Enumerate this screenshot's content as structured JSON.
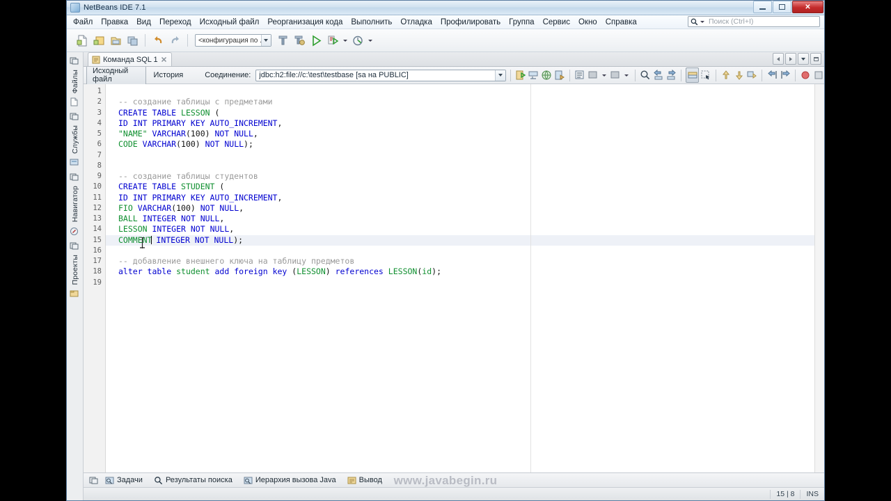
{
  "window": {
    "title": "NetBeans IDE 7.1",
    "app_icon": "netbeans-icon",
    "minimize_label": "Свернуть",
    "maximize_label": "Развернуть",
    "close_label": "Закрыть"
  },
  "menubar": {
    "items": [
      "Файл",
      "Правка",
      "Вид",
      "Переход",
      "Исходный файл",
      "Реорганизация кода",
      "Выполнить",
      "Отладка",
      "Профилировать",
      "Группа",
      "Сервис",
      "Окно",
      "Справка"
    ]
  },
  "search": {
    "placeholder": "Поиск (Ctrl+I)",
    "icon": "search-icon"
  },
  "toolbar": {
    "buttons": [
      "new-file-icon",
      "new-project-icon",
      "open-project-icon",
      "save-all-icon",
      "undo-icon",
      "redo-icon"
    ],
    "config_combo_value": "<конфигурация по ...",
    "run_buttons": [
      "build-project-icon",
      "clean-build-icon",
      "run-project-icon",
      "debug-project-icon",
      "profile-project-icon"
    ]
  },
  "sidebar": {
    "groups": [
      {
        "icon": "window-icon",
        "label": "Файлы",
        "doc_icon": "file-icon"
      },
      {
        "icon": "window-icon",
        "label": "Службы",
        "doc_icon": "services-icon"
      },
      {
        "icon": "window-icon",
        "label": "Навигатор",
        "doc_icon": "navigator-icon"
      },
      {
        "icon": "window-icon",
        "label": "Проекты",
        "doc_icon": "projects-icon"
      }
    ]
  },
  "tabs": {
    "documents": [
      {
        "label": "Команда SQL 1",
        "icon": "sql-doc-icon",
        "close": "close-icon",
        "active": true
      }
    ],
    "nav": [
      "scroll-left-icon",
      "scroll-right-icon",
      "tab-list-icon",
      "maximize-window-icon"
    ]
  },
  "editor_toolbar": {
    "view_source_label": "Исходный файл",
    "history_label": "История",
    "connection_label": "Соединение:",
    "connection_value": "jdbc:h2:file://c:\\test\\testbase [sa на PUBLIC]",
    "right_buttons": [
      "run-sql-icon",
      "run-statement-icon",
      "run-on-connection-icon",
      "sql-history-icon",
      "format-icon",
      "comment-icon",
      "uncomment-icon",
      "find-icon",
      "previous-match-icon",
      "next-match-icon",
      "toggle-rect-select-icon",
      "rect-select-icon",
      "shift-line-up-icon",
      "shift-line-down-icon",
      "copy-line-icon",
      "move-left-icon",
      "move-right-icon",
      "toggle-bookmark-icon",
      "stop-icon"
    ]
  },
  "code": {
    "lines": [
      {
        "num": "1",
        "tokens": []
      },
      {
        "num": "2",
        "tokens": [
          {
            "t": "-- создание таблицы с предметами",
            "c": "cmt"
          }
        ]
      },
      {
        "num": "3",
        "tokens": [
          {
            "t": "CREATE TABLE ",
            "c": "kw"
          },
          {
            "t": "LESSON",
            "c": "id"
          },
          {
            "t": " (",
            "c": "plain"
          }
        ]
      },
      {
        "num": "4",
        "tokens": [
          {
            "t": "ID INT PRIMARY KEY AUTO_INCREMENT",
            "c": "kw"
          },
          {
            "t": ",",
            "c": "plain"
          }
        ]
      },
      {
        "num": "5",
        "tokens": [
          {
            "t": "\"NAME\"",
            "c": "str"
          },
          {
            "t": " ",
            "c": "plain"
          },
          {
            "t": "VARCHAR",
            "c": "kw"
          },
          {
            "t": "(100) ",
            "c": "plain"
          },
          {
            "t": "NOT NULL",
            "c": "kw"
          },
          {
            "t": ",",
            "c": "plain"
          }
        ]
      },
      {
        "num": "6",
        "tokens": [
          {
            "t": "CODE",
            "c": "id"
          },
          {
            "t": " ",
            "c": "plain"
          },
          {
            "t": "VARCHAR",
            "c": "kw"
          },
          {
            "t": "(100) ",
            "c": "plain"
          },
          {
            "t": "NOT NULL",
            "c": "kw"
          },
          {
            "t": ");",
            "c": "plain"
          }
        ]
      },
      {
        "num": "7",
        "tokens": []
      },
      {
        "num": "8",
        "tokens": []
      },
      {
        "num": "9",
        "tokens": [
          {
            "t": "-- создание таблицы студентов",
            "c": "cmt"
          }
        ]
      },
      {
        "num": "10",
        "tokens": [
          {
            "t": "CREATE TABLE ",
            "c": "kw"
          },
          {
            "t": "STUDENT",
            "c": "id"
          },
          {
            "t": " (",
            "c": "plain"
          }
        ]
      },
      {
        "num": "11",
        "tokens": [
          {
            "t": "ID INT PRIMARY KEY AUTO_INCREMENT",
            "c": "kw"
          },
          {
            "t": ",",
            "c": "plain"
          }
        ]
      },
      {
        "num": "12",
        "tokens": [
          {
            "t": "FIO",
            "c": "id"
          },
          {
            "t": " ",
            "c": "plain"
          },
          {
            "t": "VARCHAR",
            "c": "kw"
          },
          {
            "t": "(100) ",
            "c": "plain"
          },
          {
            "t": "NOT NULL",
            "c": "kw"
          },
          {
            "t": ",",
            "c": "plain"
          }
        ]
      },
      {
        "num": "13",
        "tokens": [
          {
            "t": "BALL",
            "c": "id"
          },
          {
            "t": " ",
            "c": "plain"
          },
          {
            "t": "INTEGER NOT NULL",
            "c": "kw"
          },
          {
            "t": ",",
            "c": "plain"
          }
        ]
      },
      {
        "num": "14",
        "tokens": [
          {
            "t": "LESSON",
            "c": "id"
          },
          {
            "t": " ",
            "c": "plain"
          },
          {
            "t": "INTEGER NOT NULL",
            "c": "kw"
          },
          {
            "t": ",",
            "c": "plain"
          }
        ]
      },
      {
        "num": "15",
        "tokens": [
          {
            "t": "COMMENT",
            "c": "id"
          },
          {
            "t": "|CARET|",
            "c": "caret"
          },
          {
            "t": " ",
            "c": "plain"
          },
          {
            "t": "INTEGER NOT NULL",
            "c": "kw"
          },
          {
            "t": ");",
            "c": "plain"
          }
        ],
        "highlight": true
      },
      {
        "num": "16",
        "tokens": []
      },
      {
        "num": "17",
        "tokens": [
          {
            "t": "-- добавление внешнего ключа на таблицу предметов",
            "c": "cmt"
          }
        ]
      },
      {
        "num": "18",
        "tokens": [
          {
            "t": "alter table ",
            "c": "kw"
          },
          {
            "t": "student",
            "c": "id"
          },
          {
            "t": " ",
            "c": "plain"
          },
          {
            "t": "add foreign key ",
            "c": "kw"
          },
          {
            "t": "(",
            "c": "plain"
          },
          {
            "t": "LESSON",
            "c": "id"
          },
          {
            "t": ") ",
            "c": "plain"
          },
          {
            "t": "references ",
            "c": "kw"
          },
          {
            "t": "LESSON",
            "c": "id"
          },
          {
            "t": "(",
            "c": "plain"
          },
          {
            "t": "id",
            "c": "id"
          },
          {
            "t": ");",
            "c": "plain"
          }
        ]
      },
      {
        "num": "19",
        "tokens": []
      }
    ]
  },
  "bottombar": {
    "items": [
      {
        "label": "Задачи",
        "icon": "tasks-icon"
      },
      {
        "label": "Результаты поиска",
        "icon": "search-results-icon"
      },
      {
        "label": "Иерархия вызова Java",
        "icon": "call-hierarchy-icon"
      },
      {
        "label": "Вывод",
        "icon": "output-icon"
      }
    ],
    "dock_icon": "dock-icon"
  },
  "watermark": "www.javabegin.ru",
  "statusbar": {
    "position": "15 | 8",
    "insert_mode": "INS"
  },
  "colors": {
    "keyword": "#0000d0",
    "identifier": "#0f8f2f",
    "comment": "#9a9a9a",
    "highlight_line": "#eef1f7",
    "titlebar_close": "#c42b2b"
  }
}
